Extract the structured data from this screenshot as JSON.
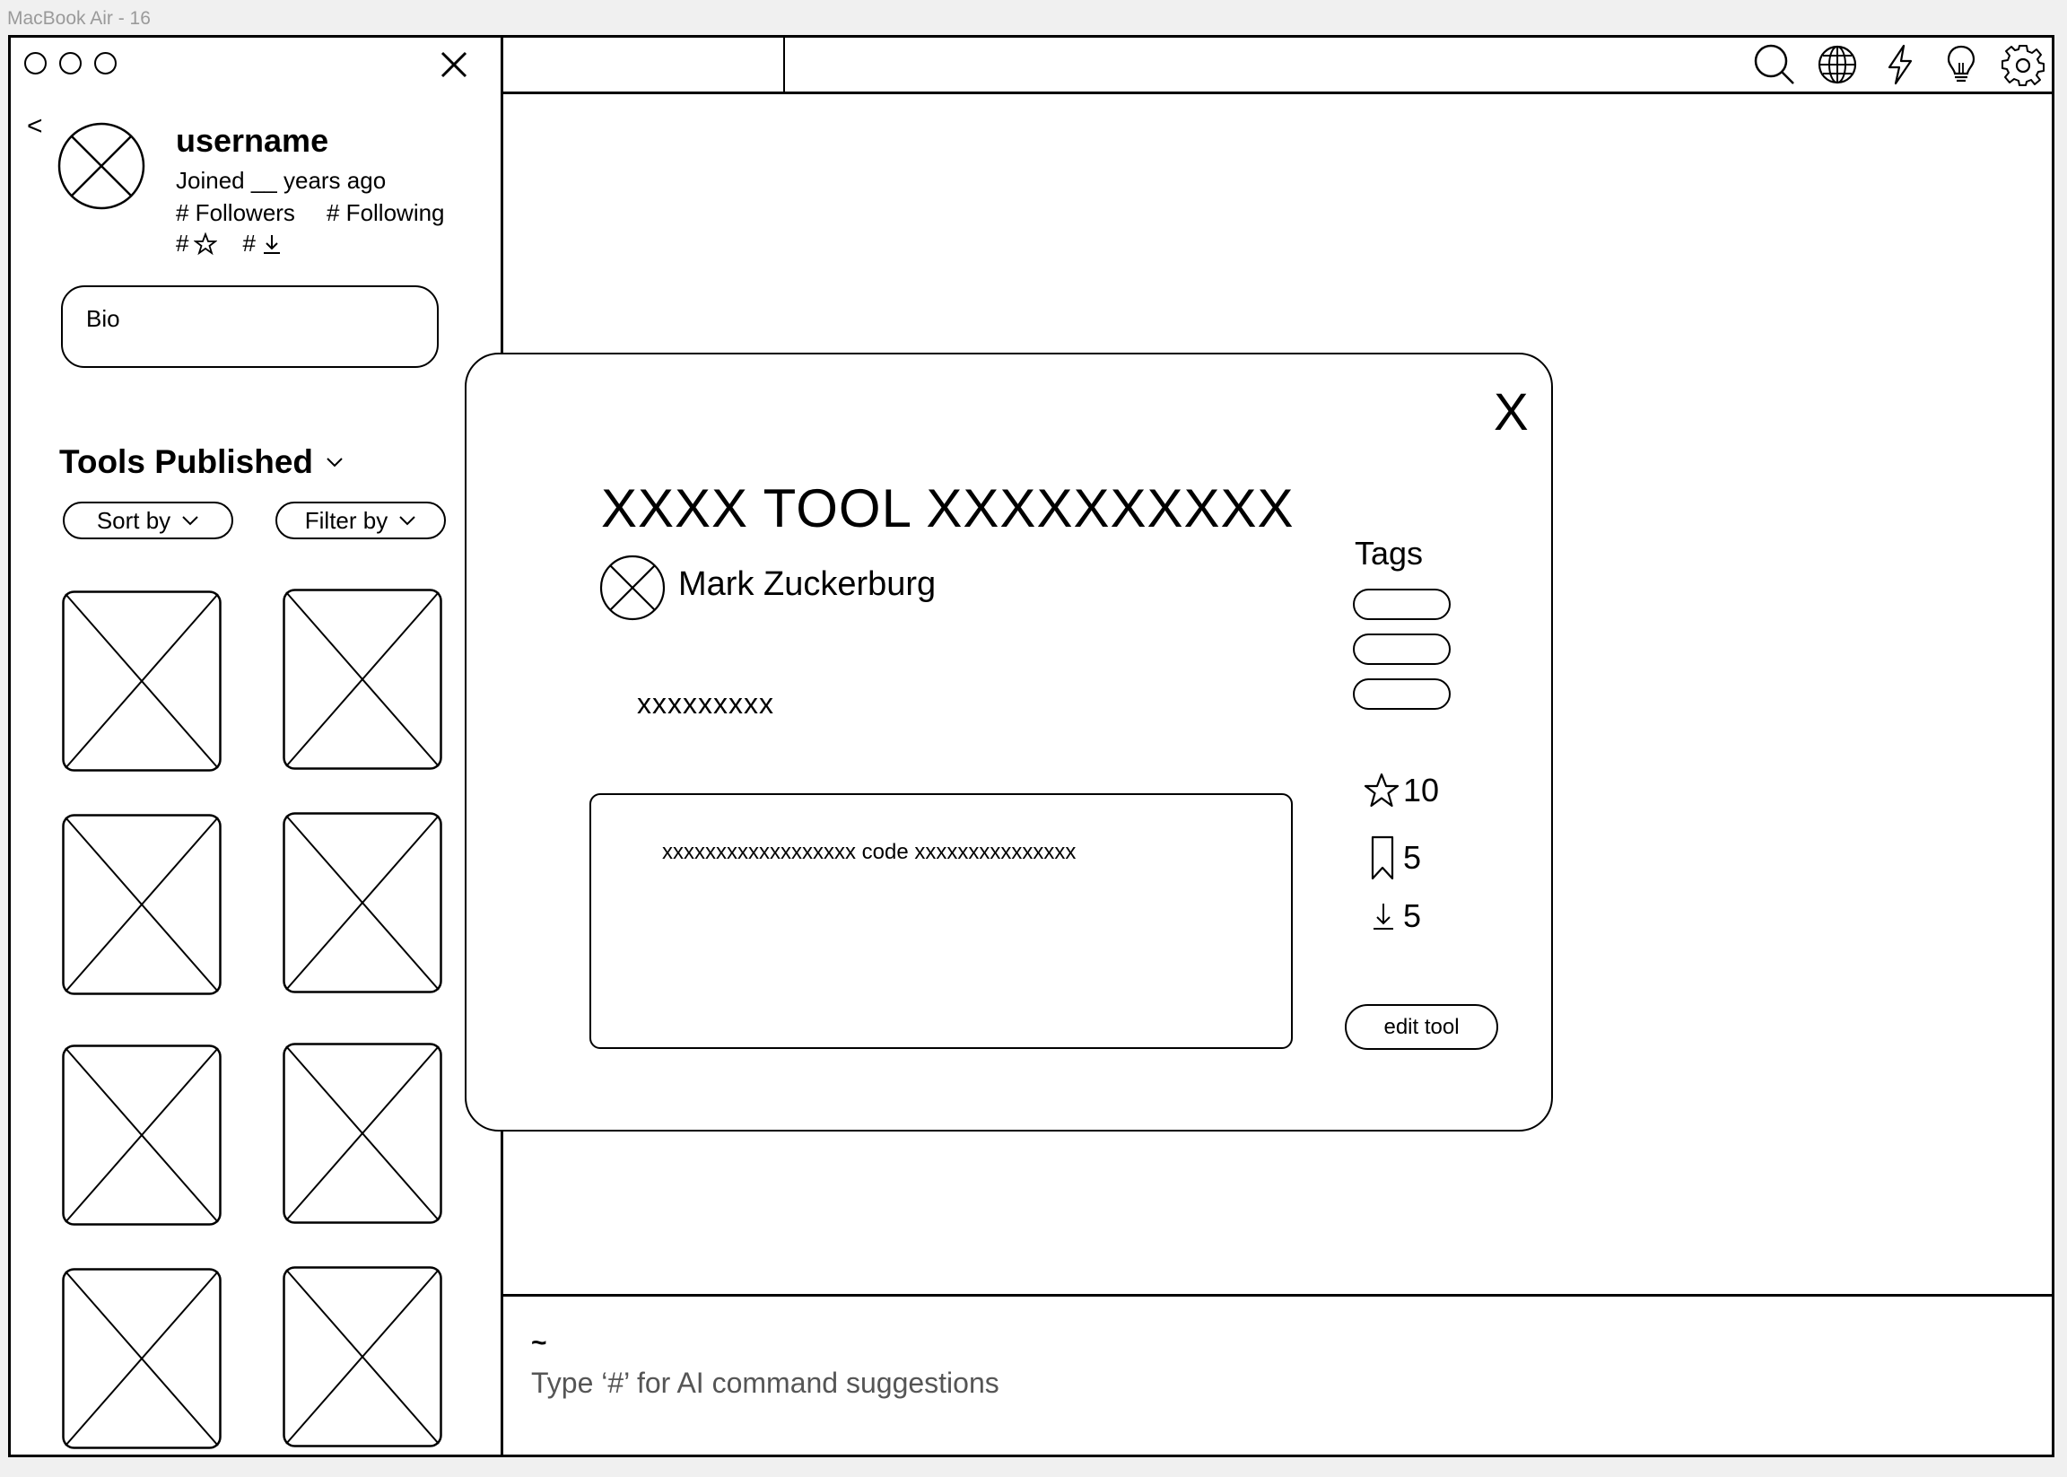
{
  "frame_label": "MacBook Air - 16",
  "profile": {
    "back": "<",
    "username": "username",
    "joined": "Joined __ years ago",
    "followers": "# Followers",
    "following": "# Following",
    "star_count_prefix": "#",
    "download_count_prefix": "#",
    "bio": "Bio"
  },
  "tools_section": {
    "title": "Tools Published",
    "sort_label": "Sort by",
    "filter_label": "Filter by"
  },
  "modal": {
    "close": "X",
    "tool_title": "XXXX TOOL XXXXXXXXXX",
    "author": "Mark Zuckerburg",
    "description": "xxxxxxxxx",
    "code": "xxxxxxxxxxxxxxxxxx code xxxxxxxxxxxxxxx",
    "tags_label": "Tags",
    "stars": "10",
    "bookmarks": "5",
    "downloads": "5",
    "edit_label": "edit tool"
  },
  "command_bar": {
    "tilde": "~",
    "placeholder": "Type ‘#’ for AI command suggestions"
  },
  "toolbar_icons": [
    "search-icon",
    "globe-icon",
    "lightning-icon",
    "lightbulb-icon",
    "gear-icon"
  ]
}
